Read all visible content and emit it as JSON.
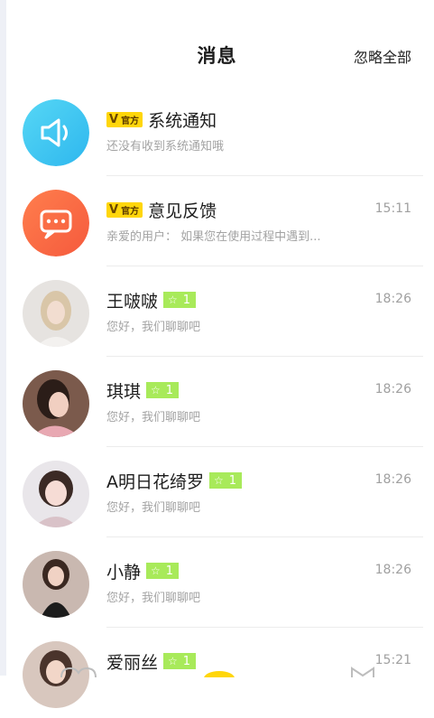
{
  "header": {
    "title": "消息",
    "ignore_all": "忽略全部"
  },
  "badges": {
    "official_label": "官方",
    "official_v": "V"
  },
  "conversations": [
    {
      "name": "系统通知",
      "official": true,
      "preview": "还没有收到系统通知哦",
      "time": "",
      "avatar": "speaker-icon"
    },
    {
      "name": "意见反馈",
      "official": true,
      "preview": "亲爱的用户： 如果您在使用过程中遇到...",
      "time": "15:11",
      "avatar": "chat-bubble-icon"
    },
    {
      "name": "王啵啵",
      "level": "1",
      "preview": "您好，我们聊聊吧",
      "time": "18:26",
      "avatar": "user-photo"
    },
    {
      "name": "琪琪",
      "level": "1",
      "preview": "您好，我们聊聊吧",
      "time": "18:26",
      "avatar": "user-photo"
    },
    {
      "name": "A明日花绮罗",
      "level": "1",
      "preview": "您好，我们聊聊吧",
      "time": "18:26",
      "avatar": "user-photo"
    },
    {
      "name": "小静",
      "level": "1",
      "preview": "您好，我们聊聊吧",
      "time": "18:26",
      "avatar": "user-photo"
    },
    {
      "name": "爱丽丝",
      "level": "1",
      "preview": "",
      "time": "15:21",
      "avatar": "user-photo"
    }
  ],
  "colors": {
    "accent_yellow": "#ffd60a",
    "level_green": "#a8ea5a",
    "system_blue": "#3fc7f0",
    "feedback_orange": "#f96a45"
  }
}
